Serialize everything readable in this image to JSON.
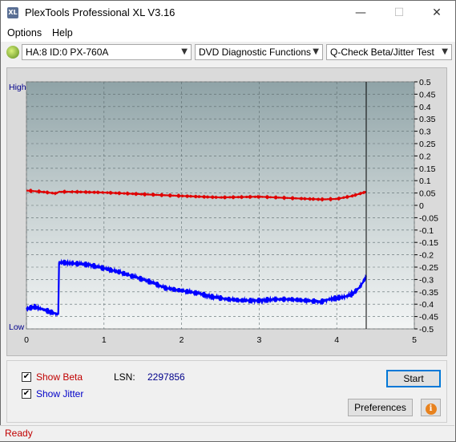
{
  "window": {
    "title": "PlexTools Professional XL V3.16",
    "icon_text": "XL",
    "minimize": "—",
    "maximize": "☐",
    "close": "✕"
  },
  "menu": {
    "options": "Options",
    "help": "Help"
  },
  "toolbar": {
    "drive": "HA:8 ID:0  PX-760A",
    "function": "DVD Diagnostic Functions",
    "test": "Q-Check Beta/Jitter Test"
  },
  "chart_data": {
    "type": "line",
    "x_ticks": [
      "0",
      "1",
      "2",
      "3",
      "4",
      "5"
    ],
    "xlim": [
      0,
      5
    ],
    "y_left_labels": {
      "high": "High",
      "low": "Low"
    },
    "y_right_ticks": [
      "0.5",
      "0.45",
      "0.4",
      "0.35",
      "0.3",
      "0.25",
      "0.2",
      "0.15",
      "0.1",
      "0.05",
      "0",
      "-0.05",
      "-0.1",
      "-0.15",
      "-0.2",
      "-0.25",
      "-0.3",
      "-0.35",
      "-0.4",
      "-0.45",
      "-0.5"
    ],
    "ylim": [
      -0.5,
      0.5
    ],
    "cursor_x": 4.38,
    "series": [
      {
        "key": "beta",
        "color": "#e00000",
        "x": [
          0,
          0.2,
          0.38,
          0.42,
          0.6,
          1.0,
          1.5,
          2.0,
          2.5,
          3.0,
          3.5,
          3.8,
          4.0,
          4.2,
          4.38
        ],
        "y": [
          0.06,
          0.055,
          0.048,
          0.055,
          0.055,
          0.052,
          0.045,
          0.038,
          0.032,
          0.035,
          0.028,
          0.024,
          0.026,
          0.038,
          0.055
        ]
      },
      {
        "key": "jitter",
        "color": "#0000ff",
        "x": [
          0,
          0.1,
          0.2,
          0.3,
          0.4,
          0.41,
          0.42,
          0.6,
          0.8,
          1.0,
          1.2,
          1.4,
          1.6,
          1.8,
          2.0,
          2.2,
          2.4,
          2.6,
          2.8,
          3.0,
          3.2,
          3.4,
          3.6,
          3.8,
          3.9,
          4.0,
          4.1,
          4.2,
          4.3,
          4.38
        ],
        "y": [
          -0.42,
          -0.41,
          -0.42,
          -0.43,
          -0.44,
          -0.44,
          -0.23,
          -0.235,
          -0.24,
          -0.255,
          -0.27,
          -0.29,
          -0.31,
          -0.335,
          -0.345,
          -0.355,
          -0.37,
          -0.38,
          -0.385,
          -0.385,
          -0.38,
          -0.38,
          -0.385,
          -0.39,
          -0.38,
          -0.375,
          -0.37,
          -0.36,
          -0.33,
          -0.29
        ]
      }
    ]
  },
  "panel": {
    "show_beta": "Show Beta",
    "show_jitter": "Show Jitter",
    "beta_checked": "✔",
    "jitter_checked": "✔",
    "lsn_label": "LSN:",
    "lsn_value": "2297856",
    "start": "Start",
    "preferences": "Preferences",
    "info_icon": "i"
  },
  "status": {
    "text": "Ready"
  }
}
